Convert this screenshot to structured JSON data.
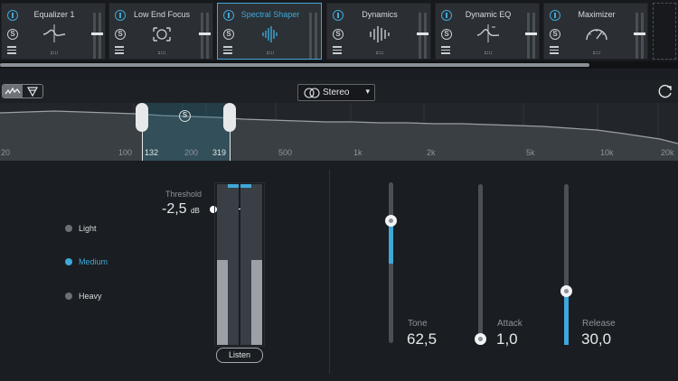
{
  "modules": [
    {
      "title": "Equalizer 1",
      "icon": "eq-curve-icon",
      "active": false,
      "menu": "⋮"
    },
    {
      "title": "Low End Focus",
      "icon": "focus-target-icon",
      "active": false
    },
    {
      "title": "Spectral Shaper",
      "icon": "spectral-bars-icon",
      "active": true
    },
    {
      "title": "Dynamics",
      "icon": "dynamics-bars-icon",
      "active": false
    },
    {
      "title": "Dynamic EQ",
      "icon": "dynamic-eq-icon",
      "active": false
    },
    {
      "title": "Maximizer",
      "icon": "gauge-icon",
      "active": false
    }
  ],
  "module_solo_glyph": "S",
  "analyzer": {
    "stereo_mode": "Stereo",
    "freq_ticks": [
      "20",
      "100",
      "200",
      "500",
      "1k",
      "2k",
      "5k",
      "10k",
      "20k"
    ],
    "band_low": "132",
    "band_high": "319",
    "band_solo_glyph": "S"
  },
  "modes": {
    "items": [
      "Light",
      "Medium",
      "Heavy"
    ],
    "selected": "Medium"
  },
  "threshold": {
    "label": "Threshold",
    "value": "-2,5",
    "unit": "dB"
  },
  "meters": {
    "left_level": 0.53,
    "right_level": 0.53
  },
  "listen_label": "Listen",
  "params": [
    {
      "name": "Tone",
      "value": "62,5",
      "level": 0.78
    },
    {
      "name": "Attack",
      "value": "1,0",
      "level": 0.0
    },
    {
      "name": "Release",
      "value": "30,0",
      "level": 0.32
    }
  ],
  "colors": {
    "accent": "#3fa8d8",
    "background": "#1a1d21",
    "module_bg": "#2b2f34"
  }
}
